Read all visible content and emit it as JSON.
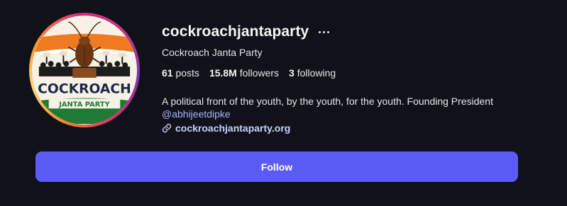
{
  "profile": {
    "username": "cockroachjantaparty",
    "display_name": "Cockroach Janta Party",
    "more_icon": "more-horizontal-icon",
    "stats": {
      "posts_count": "61",
      "posts_label": "posts",
      "followers_count": "15.8M",
      "followers_label": "followers",
      "following_count": "3",
      "following_label": "following"
    },
    "bio_text": "A political front of the youth, by the youth, for the youth. Founding President",
    "bio_mention": "@abhijeetdipke",
    "link_icon": "link-icon",
    "link_text": "cockroachjantaparty.org",
    "avatar": {
      "title_line1": "COCKROACH",
      "title_line2": "JANTA PARTY",
      "colors": {
        "saffron": "#f07a1f",
        "green": "#1f7a34",
        "navy": "#1c2a4a",
        "cockroach": "#6b3413"
      }
    }
  },
  "actions": {
    "follow_label": "Follow"
  },
  "theme": {
    "background": "#101119",
    "accent": "#5b5cf6",
    "link": "#c7d2fe"
  }
}
